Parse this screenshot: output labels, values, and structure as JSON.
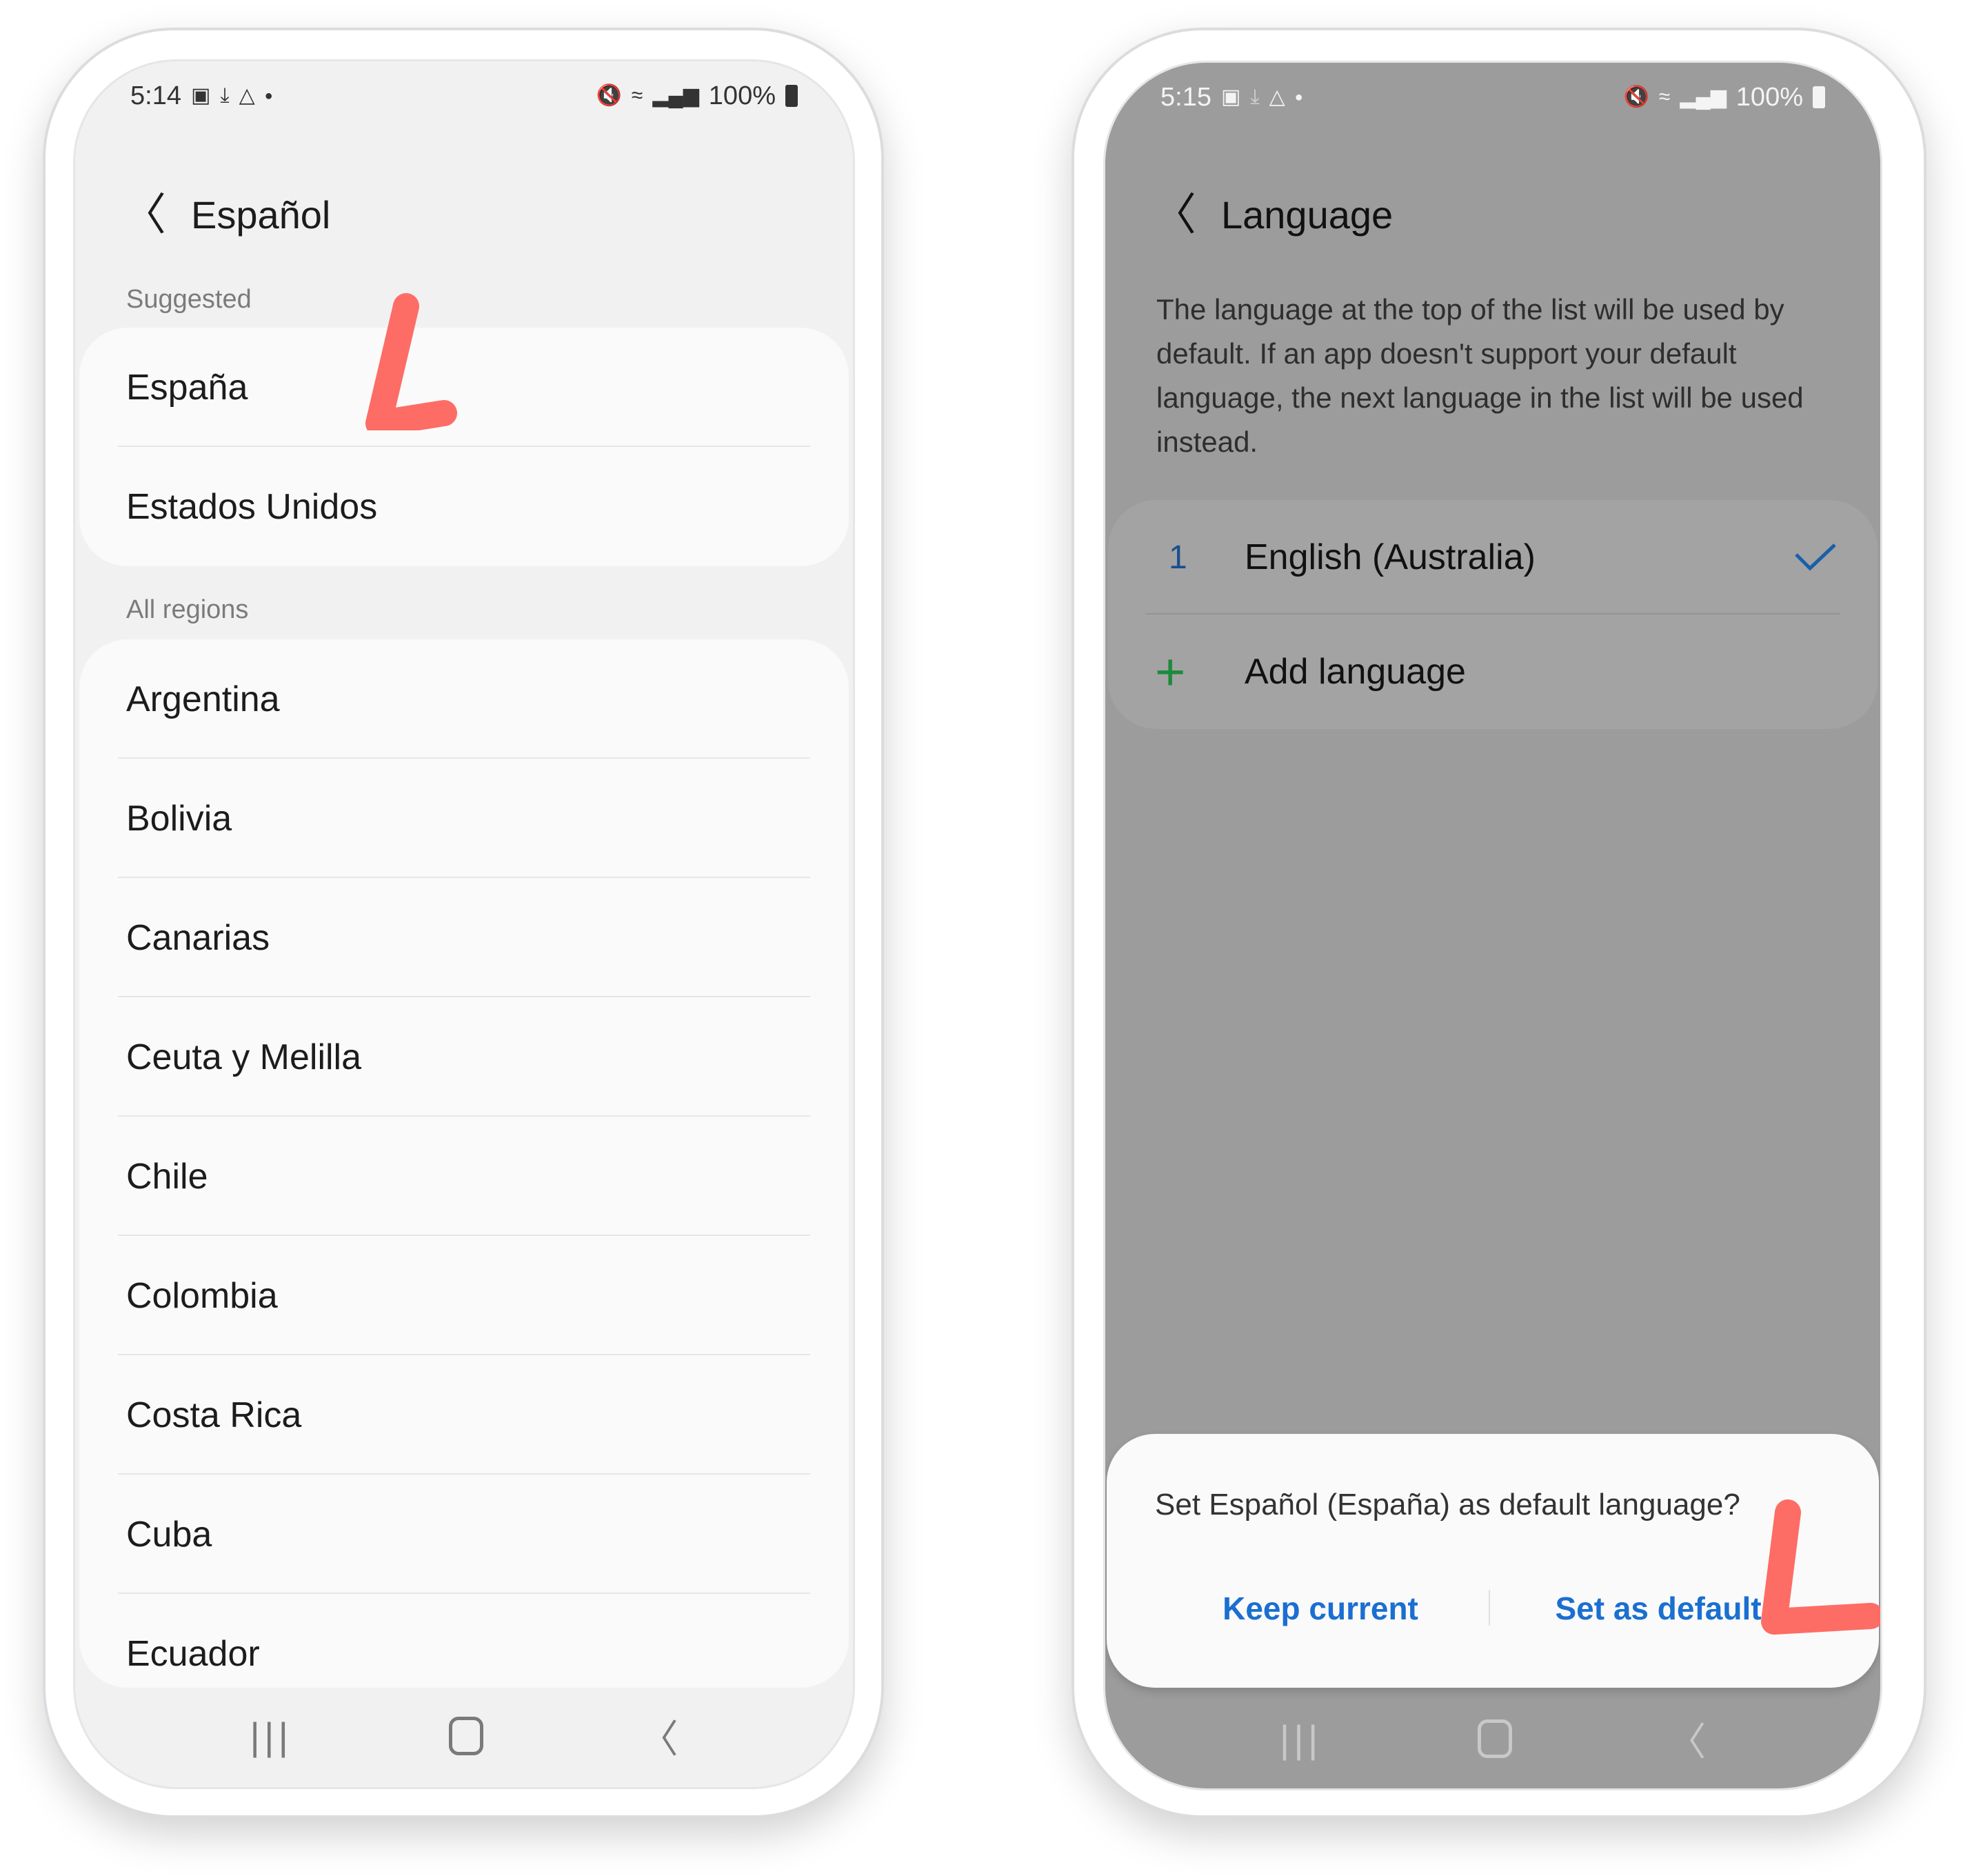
{
  "left_screen": {
    "status_bar": {
      "time": "5:14",
      "left_icons": [
        "gallery-icon",
        "download-icon",
        "drive-icon",
        "dot-icon"
      ],
      "right_icons": [
        "mute-icon",
        "wifi-icon",
        "signal-icon"
      ],
      "battery": "100%"
    },
    "header": {
      "back_icon": "chevron-left-icon",
      "title": "Español"
    },
    "sections": [
      {
        "label": "Suggested",
        "items": [
          "España",
          "Estados Unidos"
        ]
      },
      {
        "label": "All regions",
        "items": [
          "Argentina",
          "Bolivia",
          "Canarias",
          "Ceuta y Melilla",
          "Chile",
          "Colombia",
          "Costa Rica",
          "Cuba",
          "Ecuador"
        ]
      }
    ],
    "nav_bar": [
      "recents-icon",
      "home-icon",
      "back-icon"
    ]
  },
  "right_screen": {
    "status_bar": {
      "time": "5:15",
      "left_icons": [
        "gallery-icon",
        "download-icon",
        "drive-icon",
        "dot-icon"
      ],
      "right_icons": [
        "mute-icon",
        "wifi-icon",
        "signal-icon"
      ],
      "battery": "100%"
    },
    "header": {
      "back_icon": "chevron-left-icon",
      "title": "Language"
    },
    "description": "The language at the top of the list will be used by default. If an app doesn't support your default language, the next language in the list will be used instead.",
    "languages": [
      {
        "index": "1",
        "name": "English (Australia)",
        "selected": true
      }
    ],
    "add_language_label": "Add language",
    "dialog": {
      "question": "Set Español (España) as default language?",
      "keep_label": "Keep current",
      "set_label": "Set as default"
    },
    "nav_bar": [
      "recents-icon",
      "home-icon",
      "back-icon"
    ]
  },
  "colors": {
    "accent_blue": "#1a6fd1",
    "plus_green": "#1e8a3c",
    "annotation": "#fd6d65",
    "dim_overlay": "#9c9c9c",
    "light_bg": "#f1f1f1",
    "card_bg": "#fafafa"
  }
}
